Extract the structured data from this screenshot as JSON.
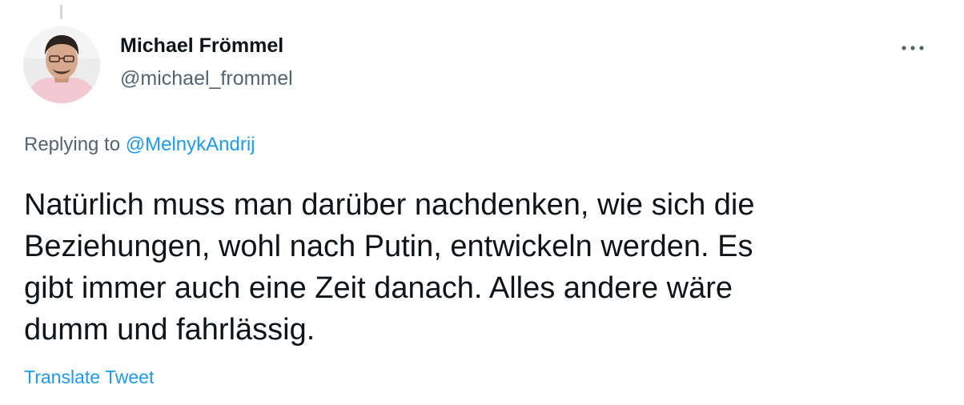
{
  "tweet": {
    "author": {
      "name": "Michael Frömmel",
      "handle": "@michael_frommel",
      "avatar_icon": "profile-photo"
    },
    "more_icon": "more-horizontal-icon",
    "replying_to_prefix": "Replying to",
    "replying_to_handle": "@MelnykAndrij",
    "text_lines": [
      "Natürlich muss man darüber nachdenken, wie sich die",
      "Beziehungen, wohl nach Putin, entwickeln werden. Es",
      "gibt immer auch eine Zeit danach. Alles andere wäre",
      "dumm und fahrlässig."
    ],
    "translate_label": "Translate Tweet"
  },
  "colors": {
    "text_primary": "#0f1419",
    "text_secondary": "#536471",
    "link": "#1d9bf0",
    "thread_line": "#cfd9de"
  }
}
